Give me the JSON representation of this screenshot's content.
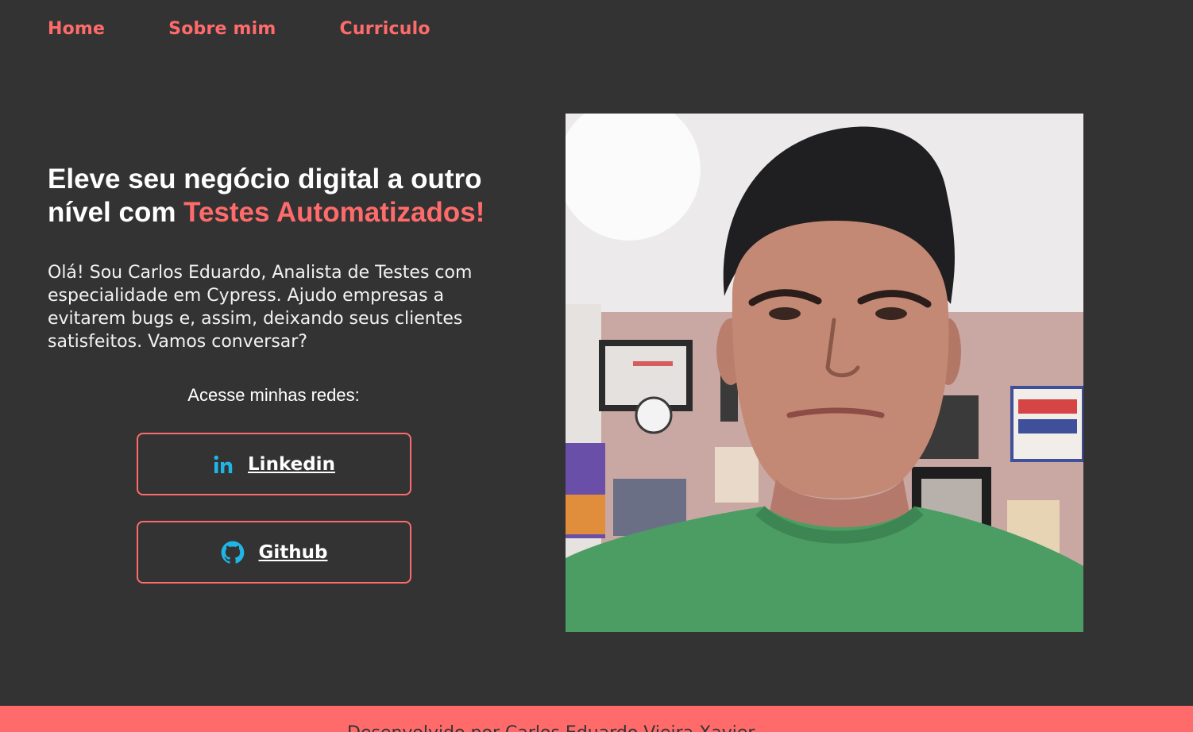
{
  "nav": {
    "items": [
      {
        "label": "Home"
      },
      {
        "label": "Sobre mim"
      },
      {
        "label": "Curriculo"
      }
    ]
  },
  "hero": {
    "headline_part1": "Eleve seu negócio digital a outro nível com ",
    "headline_accent": "Testes Automatizados!",
    "intro": "Olá! Sou Carlos Eduardo, Analista de Testes com especialidade em Cypress. Ajudo empresas a evitarem bugs e, assim, deixando seus clientes satisfeitos. Vamos conversar?",
    "networks_title": "Acesse minhas redes:"
  },
  "social": {
    "linkedin": {
      "label": "Linkedin",
      "icon": "linkedin-icon"
    },
    "github": {
      "label": "Github",
      "icon": "github-icon"
    }
  },
  "photo": {
    "alt": "profile-photo"
  },
  "footer": {
    "text": "Desenvolvido por Carlos Eduardo Vieira Xavier"
  },
  "colors": {
    "background": "#333333",
    "accent": "#ff6b6b",
    "icon": "#1fb6e6",
    "text": "#ffffff"
  }
}
